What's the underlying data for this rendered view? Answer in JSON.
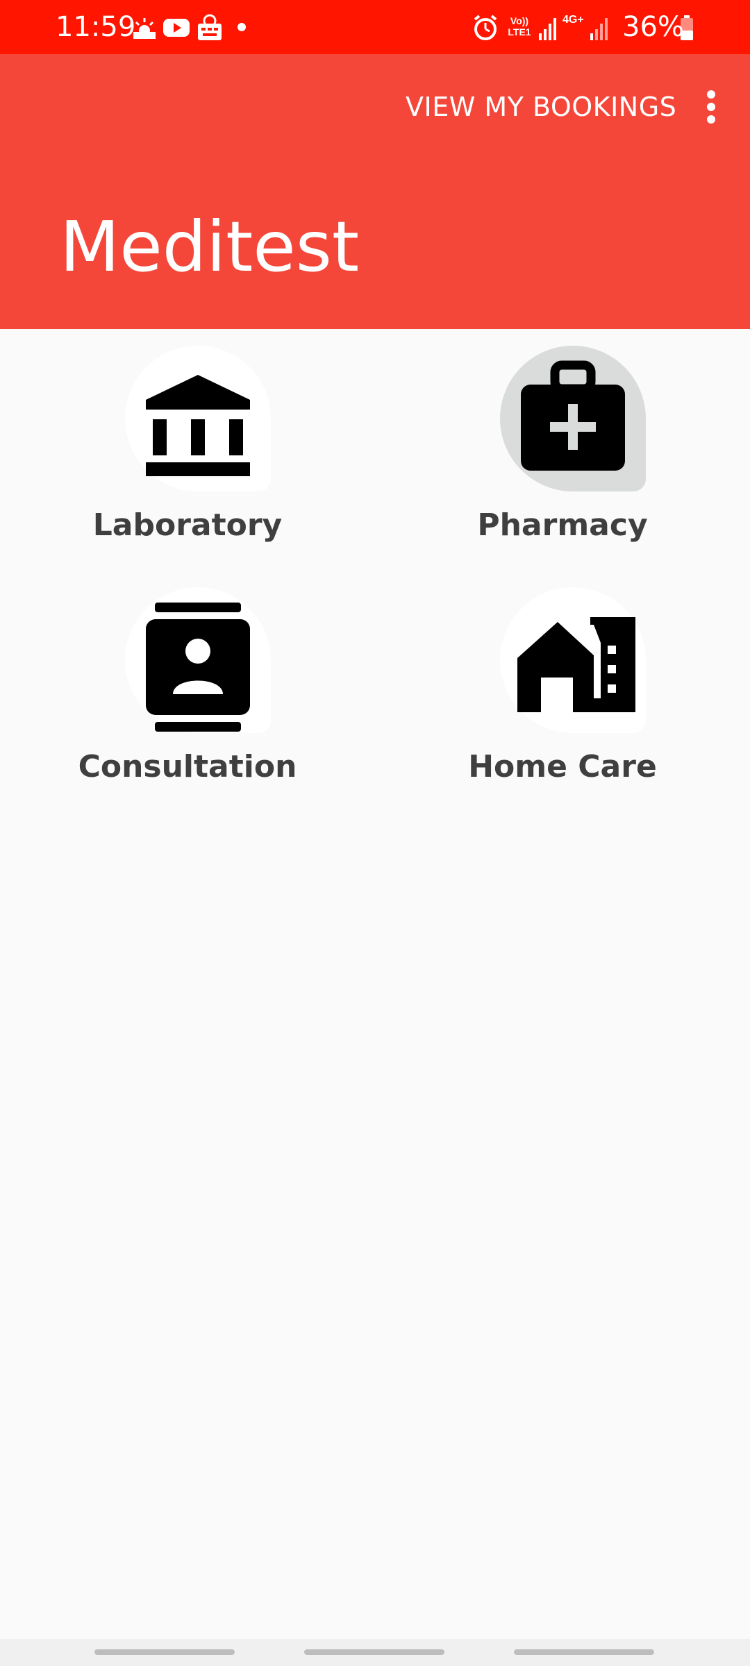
{
  "status_bar": {
    "time": "11:59",
    "battery": "36%",
    "network_label": "Vo))\nLTE1",
    "network_type": "4G+",
    "icons": [
      "weather-icon",
      "youtube-icon",
      "app-notification-icon",
      "alarm-icon",
      "volte-icon",
      "signal-icon",
      "signal-icon-2",
      "battery-icon"
    ],
    "background_color": "#FF1500"
  },
  "app_bar": {
    "title": "Meditest",
    "action_label": "VIEW MY BOOKINGS",
    "overflow_icon": "more-vert-icon",
    "background_color": "#F4473A"
  },
  "services": [
    {
      "label": "Laboratory",
      "icon": "institution-icon"
    },
    {
      "label": "Pharmacy",
      "icon": "medical-bag-icon",
      "selected": true
    },
    {
      "label": "Consultation",
      "icon": "contact-card-icon"
    },
    {
      "label": "Home Care",
      "icon": "home-building-icon"
    }
  ],
  "nav_bar": {
    "items": [
      "recents-button",
      "home-button",
      "back-button"
    ]
  }
}
